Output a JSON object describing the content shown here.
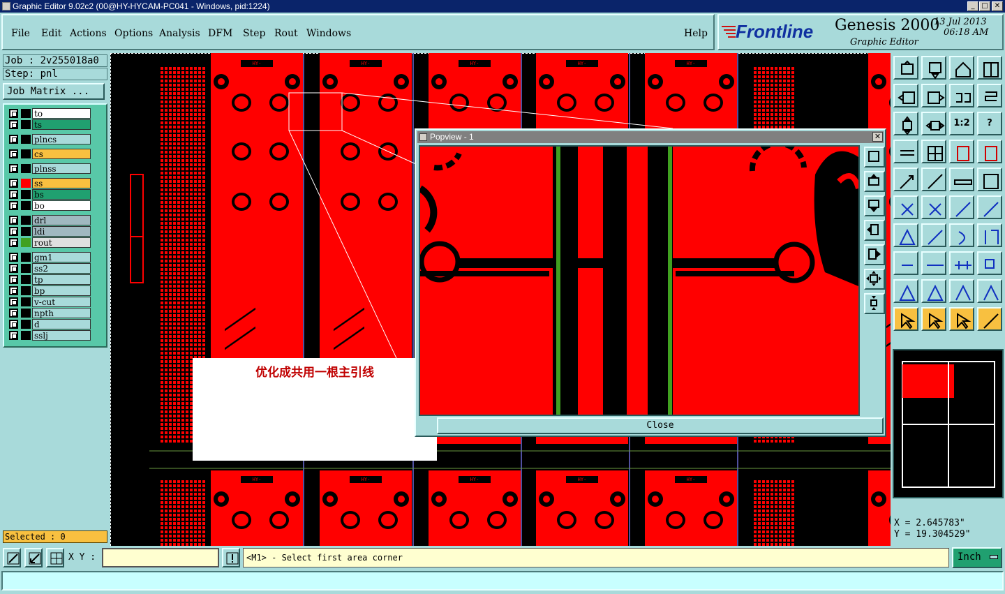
{
  "window": {
    "title": "Graphic Editor 9.02c2 (00@HY-HYCAM-PC041 - Windows, pid:1224)"
  },
  "menu": {
    "items": [
      "File",
      "Edit",
      "Actions",
      "Options",
      "Analysis",
      "DFM",
      "Step",
      "Rout",
      "Windows"
    ],
    "help": "Help"
  },
  "brand": {
    "logo": "Frontline",
    "product": "Genesis 2000",
    "subtitle": "Graphic Editor",
    "date": "13 Jul 2013",
    "time": "06:18 AM"
  },
  "job": {
    "job_label": "Job : 2v255018a0",
    "step_label": "Step: pnl",
    "matrix_button": "Job Matrix ..."
  },
  "layers": [
    {
      "name": "to",
      "color": "#ffffff",
      "swatch": ""
    },
    {
      "name": "ts",
      "color": "#20a070",
      "swatch": ""
    },
    {
      "name": "plncs",
      "color": "#a8dada",
      "swatch": ""
    },
    {
      "name": "cs",
      "color": "#f8c040",
      "swatch": ""
    },
    {
      "name": "plnss",
      "color": "#a8dada",
      "swatch": ""
    },
    {
      "name": "ss",
      "color": "#f8c040",
      "swatch": "#ff0000"
    },
    {
      "name": "bs",
      "color": "#20a070",
      "swatch": ""
    },
    {
      "name": "bo",
      "color": "#ffffff",
      "swatch": ""
    },
    {
      "name": "drl",
      "color": "#a0b8c0",
      "swatch": ""
    },
    {
      "name": "ldi",
      "color": "#a0b8c0",
      "swatch": ""
    },
    {
      "name": "rout",
      "color": "#e0e0e0",
      "swatch": "#40a020"
    },
    {
      "name": "gm1",
      "color": "#a8dada",
      "swatch": ""
    },
    {
      "name": "ss2",
      "color": "#a8dada",
      "swatch": ""
    },
    {
      "name": "tp",
      "color": "#a8dada",
      "swatch": ""
    },
    {
      "name": "bp",
      "color": "#a8dada",
      "swatch": ""
    },
    {
      "name": "v-cut",
      "color": "#a8dada",
      "swatch": ""
    },
    {
      "name": "npth",
      "color": "#a8dada",
      "swatch": ""
    },
    {
      "name": "d",
      "color": "#a8dada",
      "swatch": ""
    },
    {
      "name": "sslj",
      "color": "#a8dada",
      "swatch": ""
    }
  ],
  "selected": "Selected : 0",
  "popview": {
    "title": "Popview - 1",
    "close": "Close"
  },
  "annotation": "优化成共用一根主引线",
  "board_label": "HY-2V255018A0",
  "coords": {
    "x": "X = 2.645783\"",
    "y": "Y = 19.304529\""
  },
  "status": {
    "xy_label": "X Y :",
    "xy_value": "",
    "message": "<M1> - Select first area corner",
    "unit": "Inch"
  },
  "colors": {
    "accent": "#ff0000",
    "panel": "#a8dada",
    "layer_panel": "#58c8a8",
    "highlight": "#f8c040"
  }
}
